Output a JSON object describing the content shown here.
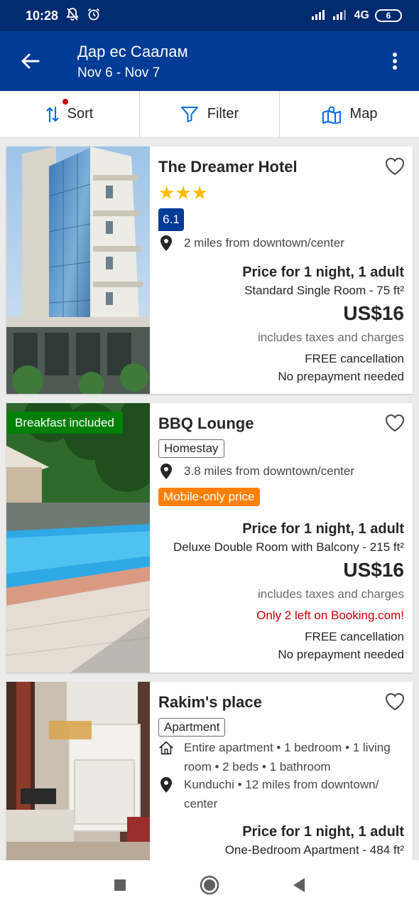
{
  "status_bar": {
    "time": "10:28",
    "network": "4G",
    "battery": "6"
  },
  "header": {
    "title": "Дар ес Саалам",
    "dates": "Nov 6 - Nov 7"
  },
  "actions": {
    "sort": "Sort",
    "filter": "Filter",
    "map": "Map"
  },
  "colors": {
    "brand": "#003b95",
    "status_bar": "#002b70",
    "star": "#febb02",
    "breakfast": "#008009",
    "mobile_price": "#ff8000",
    "scarcity": "#cc0000"
  },
  "properties": [
    {
      "name": "The Dreamer Hotel",
      "stars": "★★★",
      "score": "6.1",
      "location": "2 miles from downtown/center",
      "price_title": "Price for 1 night, 1 adult",
      "room": "Standard Single Room - 75 ft²",
      "price": "US$16",
      "taxes": "includes taxes and charges",
      "cancellation": "FREE cancellation",
      "prepayment": "No prepayment needed"
    },
    {
      "name": "BBQ Lounge",
      "photo_badge": "Breakfast included",
      "type": "Homestay",
      "location": "3.8 miles from downtown/center",
      "deal_badge": "Mobile-only price",
      "price_title": "Price for 1 night, 1 adult",
      "room": "Deluxe Double Room with Balcony - 215 ft²",
      "price": "US$16",
      "taxes": "includes taxes and charges",
      "scarcity": "Only 2 left on Booking.com!",
      "cancellation": "FREE cancellation",
      "prepayment": "No prepayment needed"
    },
    {
      "name": "Rakim's place",
      "type": "Apartment",
      "details": "Entire apartment • 1 bedroom • 1 living room • 2 beds • 1 bathroom",
      "location": "Kunduchi • 12 miles from downtown/ center",
      "price_title": "Price for 1 night, 1 adult",
      "room": "One-Bedroom Apartment - 484 ft²"
    }
  ]
}
